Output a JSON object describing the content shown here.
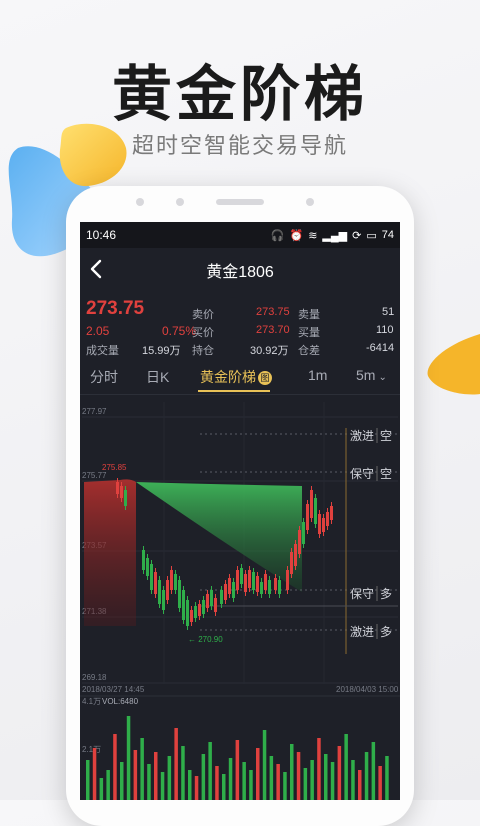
{
  "hero": {
    "title": "黄金阶梯",
    "subtitle": "超时空智能交易导航"
  },
  "colors": {
    "up": "#e0413e",
    "down": "#2fae4a",
    "accent": "#e8c157",
    "screen_bg": "#1e2028"
  },
  "status_bar": {
    "time": "10:46",
    "battery": "74",
    "icons": [
      "headphones-icon",
      "alarm-icon",
      "wifi-icon",
      "signal-icon",
      "sync-icon",
      "battery-icon"
    ]
  },
  "nav": {
    "title": "黄金1806",
    "back_icon": "chevron-left-icon"
  },
  "quote": {
    "price": "273.75",
    "change": "2.05",
    "change_pct": "0.75%",
    "volume_label": "成交量",
    "volume": "15.99万",
    "sell_price_label": "卖价",
    "sell_price": "273.75",
    "buy_price_label": "买价",
    "buy_price": "273.70",
    "open_interest_label": "持仓",
    "open_interest": "30.92万",
    "sell_vol_label": "卖量",
    "sell_vol": "51",
    "buy_vol_label": "买量",
    "buy_vol": "110",
    "oi_diff_label": "仓差",
    "oi_diff": "-6414"
  },
  "tabs": [
    {
      "label": "分时",
      "active": false
    },
    {
      "label": "日K",
      "active": false
    },
    {
      "label": "黄金阶梯",
      "active": true,
      "badge": "图"
    },
    {
      "label": "1m",
      "active": false
    },
    {
      "label": "5m",
      "active": false,
      "dropdown": true
    }
  ],
  "chart_data": {
    "type": "candlestick",
    "y_labels": [
      "277.97",
      "275.77",
      "273.57",
      "271.38",
      "269.18"
    ],
    "annotations": {
      "high": "275.85",
      "low": "270.90"
    },
    "x_labels": [
      "2018/03/27 14:45",
      "2018/04/03 15:00"
    ],
    "ylim": [
      269.18,
      277.97
    ],
    "signals": [
      {
        "label_a": "激进",
        "label_b": "空"
      },
      {
        "label_a": "保守",
        "label_b": "空"
      },
      {
        "label_a": "保守",
        "label_b": "多"
      },
      {
        "label_a": "激进",
        "label_b": "多"
      }
    ],
    "volume": {
      "max_label": "4.1万",
      "vol_label": "VOL:6480",
      "mid_label": "2.1万"
    }
  }
}
